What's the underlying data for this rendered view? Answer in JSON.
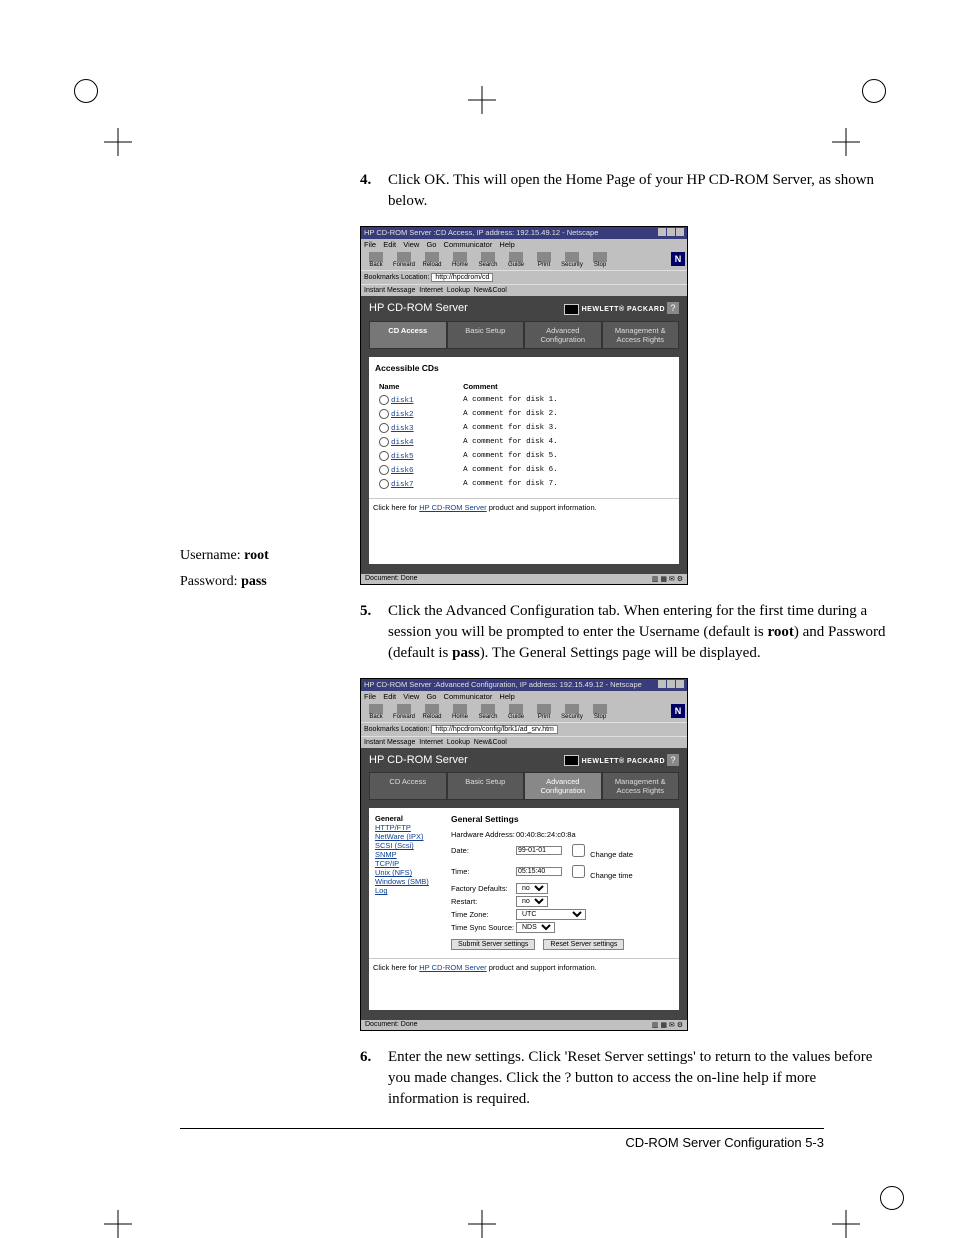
{
  "steps": {
    "item4": {
      "num": "4.",
      "text_a": "Click OK. This will open the Home Page of your HP CD-ROM Server, as shown below."
    },
    "item5": {
      "num": "5.",
      "text_a": "Click the Advanced Configuration tab. When entering for the first time during a session you will be prompted to enter the Username (default is ",
      "bold1": "root",
      "text_b": ") and Password (default is ",
      "bold2": "pass",
      "text_c": "). The General Settings page will be displayed."
    },
    "item6": {
      "num": "6.",
      "text_a": "Enter the new settings. Click 'Reset Server settings' to return to the values before you made changes. Click the ? button to access the on-line help if more information is required."
    }
  },
  "margin": {
    "user_label": "Username: ",
    "user_value": "root",
    "pass_label": "Password: ",
    "pass_value": "pass"
  },
  "netscape": {
    "menus": {
      "file": "File",
      "edit": "Edit",
      "view": "View",
      "go": "Go",
      "communicator": "Communicator",
      "help": "Help"
    },
    "toolbar": {
      "back": "Back",
      "forward": "Forward",
      "reload": "Reload",
      "home": "Home",
      "search": "Search",
      "guide": "Guide",
      "print": "Print",
      "security": "Security",
      "stop": "Stop"
    },
    "loc_label": "Bookmarks",
    "loc_prefix": "Location:",
    "linkbar": {
      "a": "Instant Message",
      "b": "Internet",
      "c": "Lookup",
      "d": "New&Cool"
    },
    "status": "Document: Done"
  },
  "fig1": {
    "title": "HP CD-ROM Server :CD Access, IP address: 192.15.49.12 - Netscape",
    "loc_value": "http://hpcdrom/cd",
    "hp_title": "HP CD-ROM Server",
    "hp_logo": "HEWLETT® PACKARD",
    "tabs": {
      "a": "CD Access",
      "b": "Basic Setup",
      "c": "Advanced Configuration",
      "d": "Management & Access Rights"
    },
    "panel_head": "Accessible CDs",
    "col_name": "Name",
    "col_comment": "Comment",
    "disks": [
      {
        "name": "disk1",
        "comment": "A comment for disk 1."
      },
      {
        "name": "disk2",
        "comment": "A comment for disk 2."
      },
      {
        "name": "disk3",
        "comment": "A comment for disk 3."
      },
      {
        "name": "disk4",
        "comment": "A comment for disk 4."
      },
      {
        "name": "disk5",
        "comment": "A comment for disk 5."
      },
      {
        "name": "disk6",
        "comment": "A comment for disk 6."
      },
      {
        "name": "disk7",
        "comment": "A comment for disk 7."
      }
    ],
    "footlink_a": "Click here for ",
    "footlink_b": "HP CD-ROM Server",
    "footlink_c": " product and support information."
  },
  "fig2": {
    "title": "HP CD-ROM Server :Advanced Configuration, IP address: 192.15.49.12 - Netscape",
    "loc_value": "http://hpcdrom/config/lbrk1/ad_srv.htm",
    "hp_title": "HP CD-ROM Server",
    "hp_logo": "HEWLETT® PACKARD",
    "tabs": {
      "a": "CD Access",
      "b": "Basic Setup",
      "c": "Advanced Configuration",
      "d": "Management & Access Rights"
    },
    "panel_head": "General Settings",
    "side": {
      "head": "General",
      "links": [
        "HTTP/FTP",
        "NetWare (IPX)",
        "SCSI (Scsi)",
        "SNMP",
        "TCP/IP",
        "Unix (NFS)",
        "Windows (SMB)",
        "Log"
      ]
    },
    "form": {
      "hwaddr_lbl": "Hardware Address:",
      "hwaddr_val": "00:40:8c:24:c0:8a",
      "date_lbl": "Date:",
      "date_val": "99-01-01",
      "date_chk": "Change date",
      "time_lbl": "Time:",
      "time_val": "05:15:40",
      "time_chk": "Change time",
      "fdef_lbl": "Factory Defaults:",
      "fdef_val": "no",
      "restart_lbl": "Restart:",
      "restart_val": "no",
      "tz_lbl": "Time Zone:",
      "tz_val": "UTC",
      "tsrc_lbl": "Time Sync Source:",
      "tsrc_val": "NDS",
      "submit": "Submit Server settings",
      "reset": "Reset Server settings"
    },
    "footlink_a": "Click here for ",
    "footlink_b": "HP CD-ROM Server",
    "footlink_c": " product and support information."
  },
  "footer": "CD-ROM Server Configuration 5-3"
}
